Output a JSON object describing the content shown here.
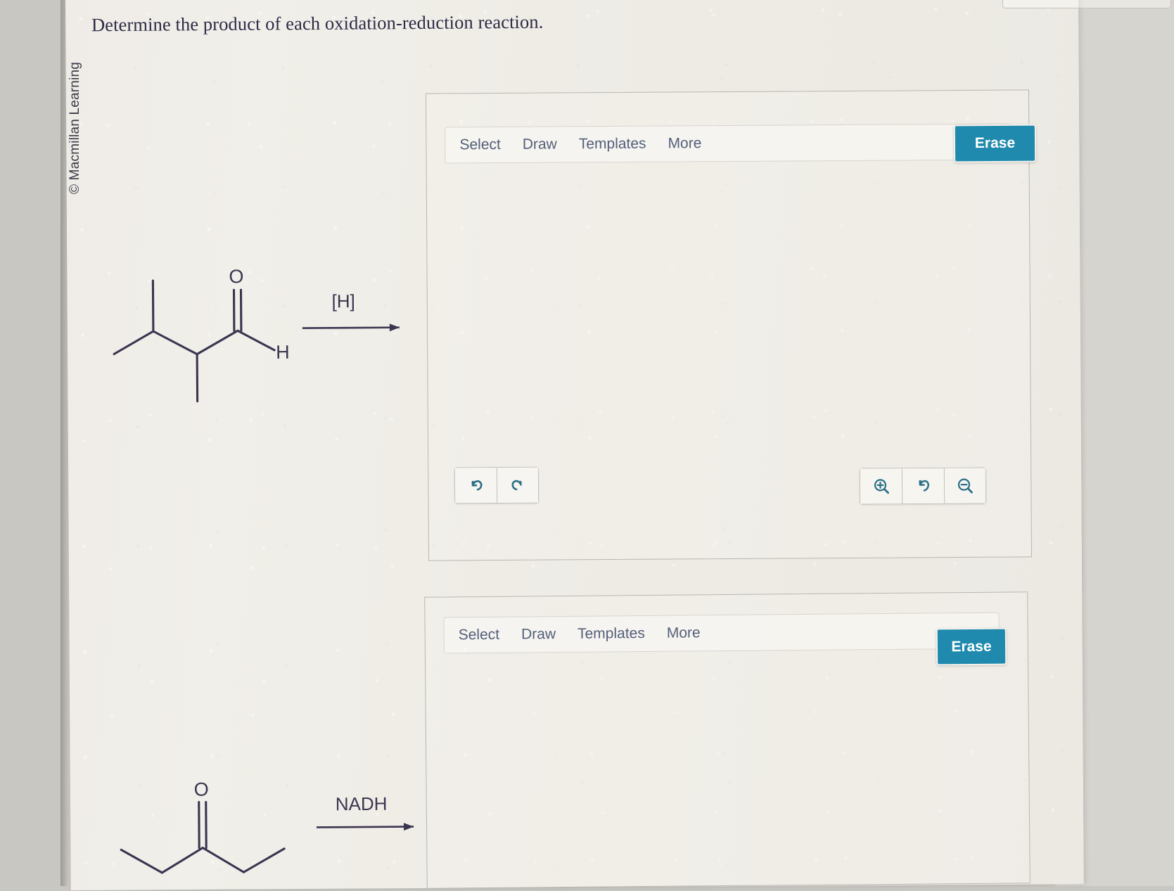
{
  "page": {
    "title": "Determine the product of each oxidation-reduction reaction.",
    "copyright": "© Macmillan Learning",
    "accent_color": "#1f8aad",
    "bond_color": "#3b3550",
    "panel_border_color": "#b9b6b1"
  },
  "editors": [
    {
      "id": "editor-1",
      "toolbar": {
        "menu": [
          {
            "label": "Select",
            "name": "select"
          },
          {
            "label": "Draw",
            "name": "draw"
          },
          {
            "label": "Templates",
            "name": "templates"
          },
          {
            "label": "More",
            "name": "more"
          }
        ],
        "erase_label": "Erase"
      },
      "history": [
        {
          "name": "undo-icon",
          "title": "Undo"
        },
        {
          "name": "redo-icon",
          "title": "Redo"
        }
      ],
      "zoom_controls": [
        {
          "name": "zoom-in-icon",
          "title": "Zoom in"
        },
        {
          "name": "zoom-reset-icon",
          "title": "Reset zoom"
        },
        {
          "name": "zoom-out-icon",
          "title": "Zoom out"
        }
      ]
    },
    {
      "id": "editor-2",
      "toolbar": {
        "menu": [
          {
            "label": "Select",
            "name": "select"
          },
          {
            "label": "Draw",
            "name": "draw"
          },
          {
            "label": "Templates",
            "name": "templates"
          },
          {
            "label": "More",
            "name": "more"
          }
        ],
        "erase_label": "Erase"
      }
    }
  ],
  "reactions": [
    {
      "id": "reaction-1",
      "reagent": "[H]",
      "atom_labels": {
        "carbonyl_oxygen": "O",
        "aldehyde_hydrogen": "H"
      },
      "description": "2,3-dimethylbutanal skeletal structure with reduction arrow"
    },
    {
      "id": "reaction-2",
      "reagent": "NADH",
      "atom_labels": {
        "carbonyl_oxygen": "O"
      },
      "description": "ketone skeletal structure with NADH reduction arrow"
    }
  ]
}
